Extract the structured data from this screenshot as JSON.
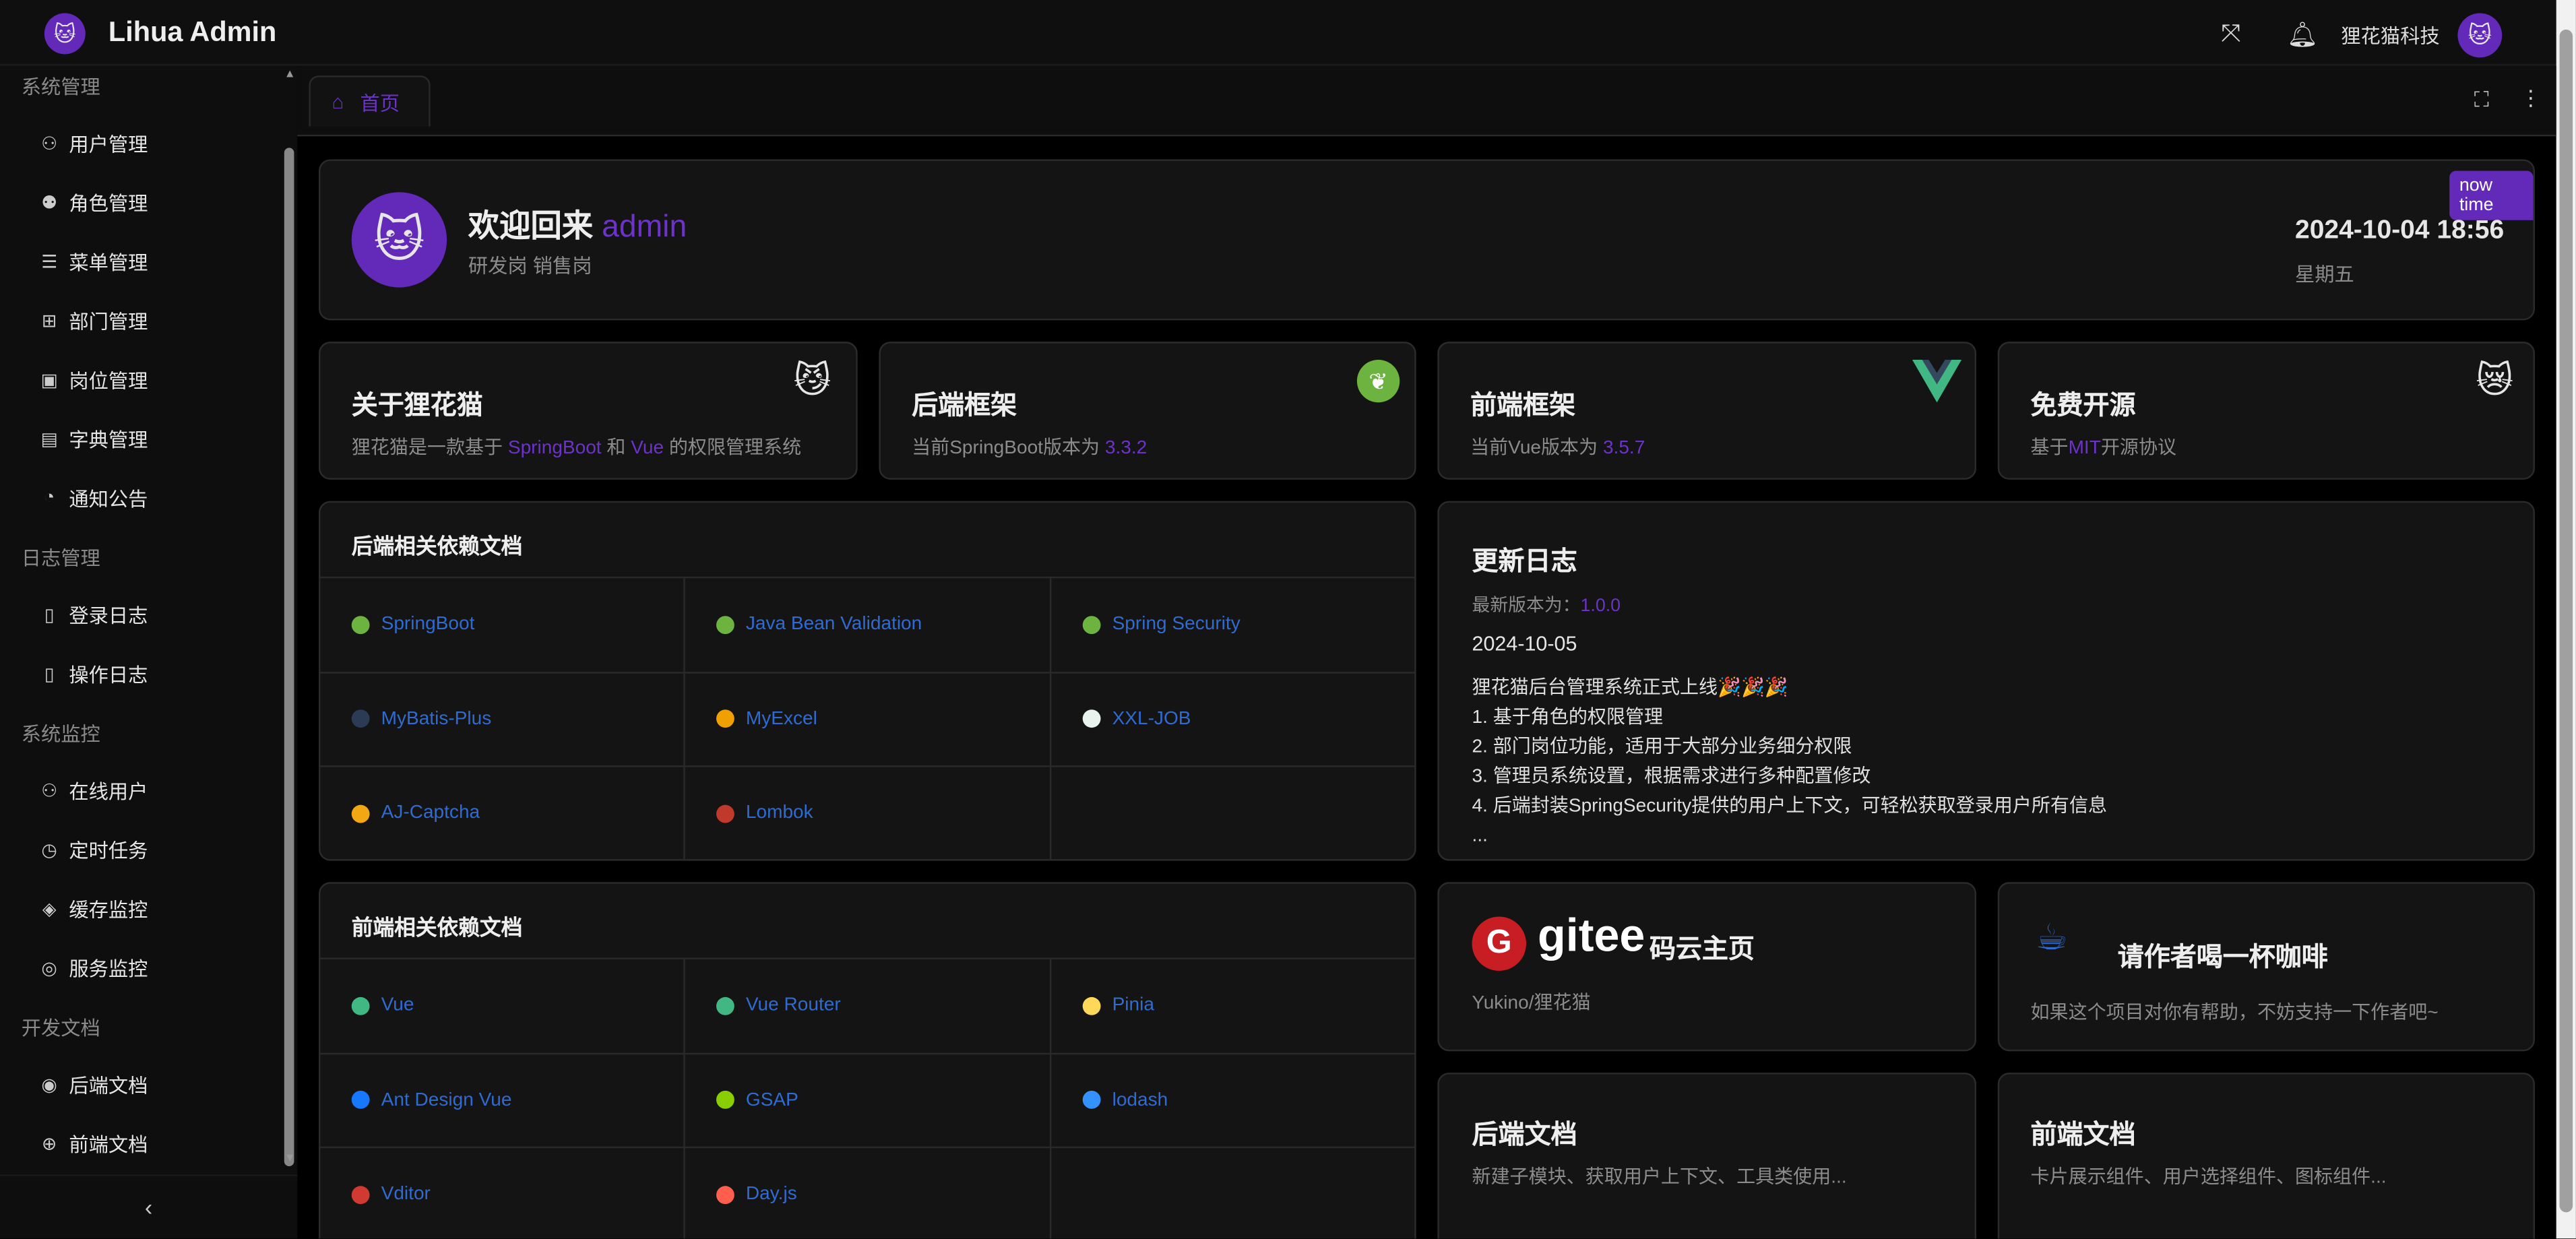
{
  "header": {
    "app_title": "Lihua Admin",
    "company": "狸花猫科技"
  },
  "sidebar": {
    "groups": [
      {
        "label": "系统管理",
        "items": [
          {
            "label": "用户管理",
            "icon": "user-icon"
          },
          {
            "label": "角色管理",
            "icon": "role-icon"
          },
          {
            "label": "菜单管理",
            "icon": "menu-list-icon"
          },
          {
            "label": "部门管理",
            "icon": "org-tree-icon"
          },
          {
            "label": "岗位管理",
            "icon": "post-icon"
          },
          {
            "label": "字典管理",
            "icon": "dictionary-icon"
          },
          {
            "label": "通知公告",
            "icon": "notice-icon"
          }
        ]
      },
      {
        "label": "日志管理",
        "items": [
          {
            "label": "登录日志",
            "icon": "login-log-icon"
          },
          {
            "label": "操作日志",
            "icon": "operation-log-icon"
          }
        ]
      },
      {
        "label": "系统监控",
        "items": [
          {
            "label": "在线用户",
            "icon": "online-user-icon"
          },
          {
            "label": "定时任务",
            "icon": "clock-icon"
          },
          {
            "label": "缓存监控",
            "icon": "cache-icon"
          },
          {
            "label": "服务监控",
            "icon": "server-icon"
          }
        ]
      },
      {
        "label": "开发文档",
        "items": [
          {
            "label": "后端文档",
            "icon": "eye-icon"
          },
          {
            "label": "前端文档",
            "icon": "globe-icon"
          }
        ]
      }
    ]
  },
  "tabs": [
    {
      "label": "首页"
    }
  ],
  "welcome": {
    "greeting": "欢迎回来",
    "username": "admin",
    "posts": "研发岗 销售岗",
    "badge": "now time",
    "datetime": "2024-10-04 18:56",
    "weekday": "星期五"
  },
  "info_cards": [
    {
      "title": "关于狸花猫",
      "desc_pre": "狸花猫是一款基于 ",
      "link1": "SpringBoot",
      "mid": " 和 ",
      "link2": "Vue",
      "desc_post": " 的权限管理系统"
    },
    {
      "title": "后端框架",
      "desc_pre": "当前SpringBoot版本为 ",
      "version": "3.3.2"
    },
    {
      "title": "前端框架",
      "desc_pre": "当前Vue版本为 ",
      "version": "3.5.7"
    },
    {
      "title": "免费开源",
      "desc_pre": "基于",
      "link": "MIT",
      "desc_post": "开源协议"
    }
  ],
  "backend_deps": {
    "title": "后端相关依赖文档",
    "items": [
      "SpringBoot",
      "Java Bean Validation",
      "Spring Security",
      "MyBatis-Plus",
      "MyExcel",
      "XXL-JOB",
      "AJ-Captcha",
      "Lombok"
    ]
  },
  "frontend_deps": {
    "title": "前端相关依赖文档",
    "items": [
      "Vue",
      "Vue Router",
      "Pinia",
      "Ant Design Vue",
      "GSAP",
      "lodash",
      "Vditor",
      "Day.js"
    ]
  },
  "changelog": {
    "title": "更新日志",
    "version_label": "最新版本为：",
    "version": "1.0.0",
    "date": "2024-10-05",
    "headline": "狸花猫后台管理系统正式上线🎉🎉🎉",
    "lines": [
      "1. 基于角色的权限管理",
      "2. 部门岗位功能，适用于大部分业务细分权限",
      "3. 管理员系统设置，根据需求进行多种配置修改",
      "4. 后端封装SpringSecurity提供的用户上下文，可轻松获取登录用户所有信息",
      "..."
    ]
  },
  "gitee": {
    "logo_text": "gitee",
    "title": "码云主页",
    "desc": "Yukino/狸花猫"
  },
  "coffee": {
    "title": "请作者喝一杯咖啡",
    "desc": "如果这个项目对你有帮助，不妨支持一下作者吧~"
  },
  "doc_cards": [
    {
      "title": "后端文档",
      "desc": "新建子模块、获取用户上下文、工具类使用..."
    },
    {
      "title": "前端文档",
      "desc": "卡片展示组件、用户选择组件、图标组件..."
    }
  ],
  "colors": {
    "accent": "#6329b8",
    "link": "#2f6bd0",
    "card_bg": "#141414"
  }
}
